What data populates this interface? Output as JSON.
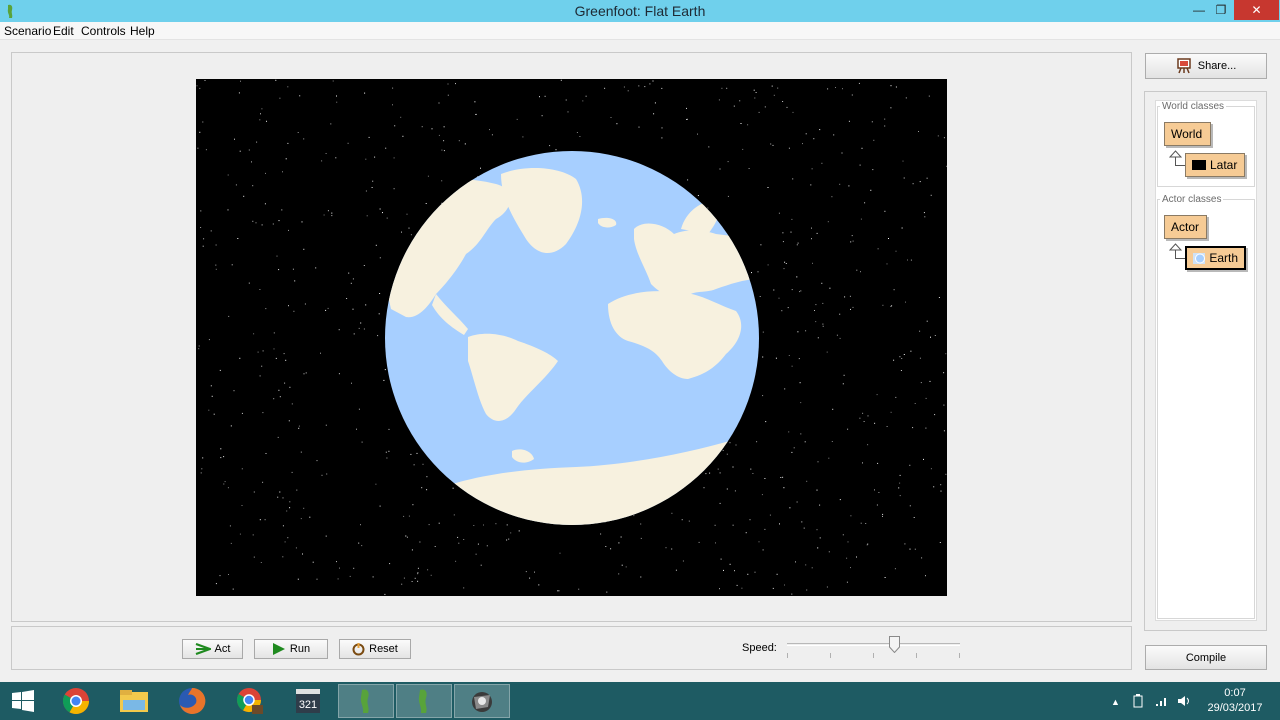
{
  "window": {
    "title": "Greenfoot: Flat Earth"
  },
  "menu": [
    "Scenario",
    "Edit",
    "Controls",
    "Help"
  ],
  "controls": {
    "act_label": "Act",
    "run_label": "Run",
    "reset_label": "Reset",
    "speed_label": "Speed:",
    "speed_level": 0.62
  },
  "share_label": "Share...",
  "world_classes": {
    "title": "World classes",
    "root": "World",
    "child": "Latar"
  },
  "actor_classes": {
    "title": "Actor classes",
    "root": "Actor",
    "child": "Earth"
  },
  "compile_label": "Compile",
  "taskbar": {
    "apps": [
      "windows-start-icon",
      "chrome-icon",
      "file-explorer-icon",
      "firefox-icon",
      "chrome-app-icon",
      "media-player-icon",
      "greenfoot-icon",
      "greenfoot-icon",
      "game-icon"
    ],
    "clock_time": "0:07",
    "clock_date": "29/03/2017"
  },
  "colors": {
    "titlebar": "#6fd0ec",
    "close": "#c7372f",
    "class_box": "#f6cb95",
    "taskbar": "#1e5b63",
    "ocean": "#a7cfff",
    "land": "#f7f1df"
  }
}
